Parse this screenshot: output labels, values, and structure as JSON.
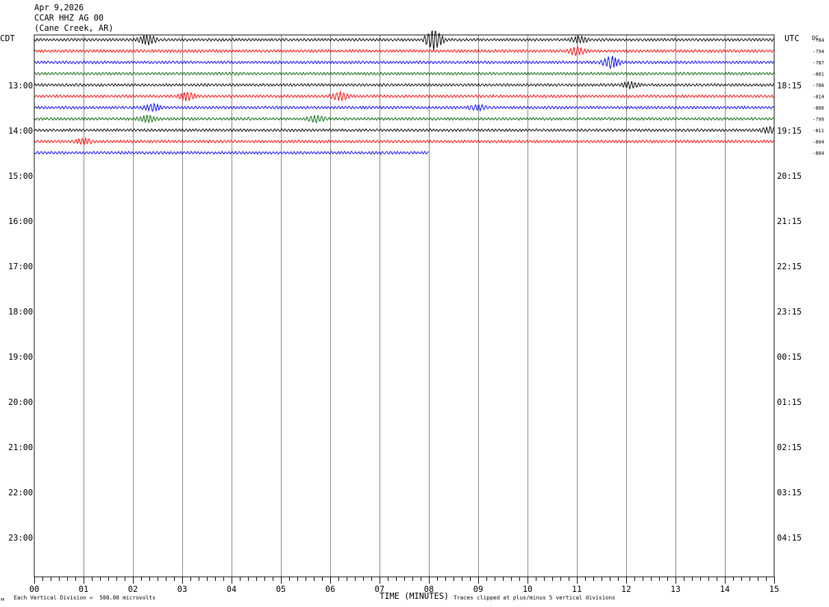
{
  "header": {
    "date": "Apr 9,2026",
    "station": "CCAR HHZ AG 00",
    "location": "(Cane Creek, AR)"
  },
  "colors": {
    "trace_cycle": [
      "#000000",
      "#ff0000",
      "#0000ff",
      "#006400"
    ],
    "grid": "#808080",
    "frame": "#000000"
  },
  "chart_data": {
    "type": "line",
    "title": "CCAR HHZ AG 00",
    "xlabel": "TIME (MINUTES)",
    "ylabel_left": "CDT",
    "ylabel_right": "UTC",
    "dc_label": "DC",
    "xlim": [
      0,
      15
    ],
    "x_ticks": [
      "00",
      "01",
      "02",
      "03",
      "04",
      "05",
      "06",
      "07",
      "08",
      "09",
      "10",
      "11",
      "12",
      "13",
      "14",
      "15"
    ],
    "left_hour_labels": [
      "13:00",
      "14:00",
      "15:00",
      "16:00",
      "17:00",
      "18:00",
      "19:00",
      "20:00",
      "21:00",
      "22:00",
      "23:00"
    ],
    "right_hour_labels": [
      "18:15",
      "19:15",
      "20:15",
      "21:15",
      "22:15",
      "23:15",
      "00:15",
      "01:15",
      "02:15",
      "03:15",
      "04:15"
    ],
    "traces_per_hour": 4,
    "first_trace_offset": -4,
    "total_rows": 48,
    "traces": [
      {
        "row": 0,
        "color": "black",
        "dc": "-784",
        "end_minute": 15,
        "events": [
          {
            "t": 2.3,
            "amp": 2.5
          },
          {
            "t": 8.1,
            "amp": 5.5
          },
          {
            "t": 11.05,
            "amp": 1.5
          }
        ]
      },
      {
        "row": 1,
        "color": "red",
        "dc": "-794",
        "end_minute": 15,
        "events": [
          {
            "t": 11.0,
            "amp": 2.0
          }
        ]
      },
      {
        "row": 2,
        "color": "blue",
        "dc": "-787",
        "end_minute": 15,
        "events": [
          {
            "t": 11.7,
            "amp": 3.0
          }
        ]
      },
      {
        "row": 3,
        "color": "green",
        "dc": "-801",
        "end_minute": 15,
        "events": []
      },
      {
        "row": 4,
        "color": "black",
        "dc": "-788",
        "end_minute": 15,
        "events": [
          {
            "t": 12.1,
            "amp": 1.5
          }
        ]
      },
      {
        "row": 5,
        "color": "red",
        "dc": "-814",
        "end_minute": 15,
        "events": [
          {
            "t": 3.1,
            "amp": 2.0
          },
          {
            "t": 6.2,
            "amp": 2.0
          }
        ]
      },
      {
        "row": 6,
        "color": "blue",
        "dc": "-806",
        "end_minute": 15,
        "events": [
          {
            "t": 2.4,
            "amp": 1.6
          },
          {
            "t": 9.0,
            "amp": 1.2
          }
        ]
      },
      {
        "row": 7,
        "color": "green",
        "dc": "-799",
        "end_minute": 15,
        "events": [
          {
            "t": 2.3,
            "amp": 1.5
          },
          {
            "t": 5.7,
            "amp": 1.5
          }
        ]
      },
      {
        "row": 8,
        "color": "black",
        "dc": "-811",
        "end_minute": 15,
        "events": [
          {
            "t": 14.9,
            "amp": 1.5
          }
        ]
      },
      {
        "row": 9,
        "color": "red",
        "dc": "-804",
        "end_minute": 15,
        "events": [
          {
            "t": 1.0,
            "amp": 1.2
          }
        ]
      },
      {
        "row": 10,
        "color": "blue",
        "dc": "-804",
        "end_minute": 8,
        "events": []
      }
    ]
  },
  "footer": {
    "scale_note": "Each Vertical Division =  500.00 microvolts",
    "clip_note": "Traces clipped at plus/minus 5 vertical divisions",
    "corner_mark": "ᴍ"
  }
}
